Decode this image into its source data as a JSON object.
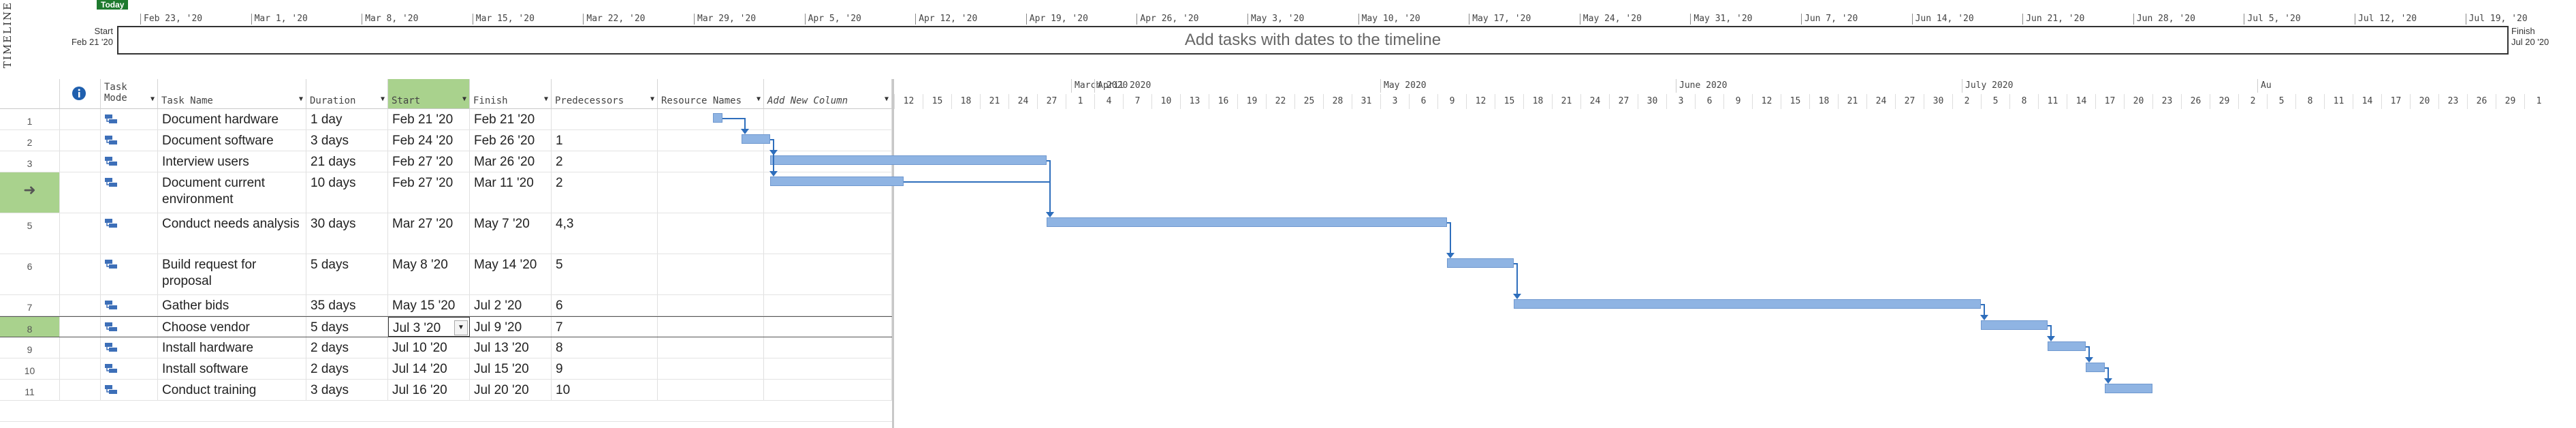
{
  "timeline": {
    "label": "TIMELINE",
    "today": "Today",
    "start_label": "Start",
    "start_date": "Feb 21 '20",
    "finish_label": "Finish",
    "finish_date": "Jul 20 '20",
    "placeholder": "Add tasks with dates to the timeline",
    "ticks": [
      "Feb 23, '20",
      "Mar 1, '20",
      "Mar 8, '20",
      "Mar 15, '20",
      "Mar 22, '20",
      "Mar 29, '20",
      "Apr 5, '20",
      "Apr 12, '20",
      "Apr 19, '20",
      "Apr 26, '20",
      "May 3, '20",
      "May 10, '20",
      "May 17, '20",
      "May 24, '20",
      "May 31, '20",
      "Jun 7, '20",
      "Jun 14, '20",
      "Jun 21, '20",
      "Jun 28, '20",
      "Jul 5, '20",
      "Jul 12, '20",
      "Jul 19, '20"
    ]
  },
  "columns": {
    "info_icon": "info-icon",
    "task_mode": "Task Mode",
    "task_name": "Task Name",
    "duration": "Duration",
    "start": "Start",
    "finish": "Finish",
    "predecessors": "Predecessors",
    "resource_names": "Resource Names",
    "add_new_column": "Add New Column"
  },
  "tasks": [
    {
      "id": "1",
      "name": "Document hardware",
      "duration": "1 day",
      "start": "Feb 21 '20",
      "finish": "Feb 21 '20",
      "pred": ""
    },
    {
      "id": "2",
      "name": "Document software",
      "duration": "3 days",
      "start": "Feb 24 '20",
      "finish": "Feb 26 '20",
      "pred": "1"
    },
    {
      "id": "3",
      "name": "Interview users",
      "duration": "21 days",
      "start": "Feb 27 '20",
      "finish": "Mar 26 '20",
      "pred": "2"
    },
    {
      "id": "4",
      "name": "Document current environment",
      "duration": "10 days",
      "start": "Feb 27 '20",
      "finish": "Mar 11 '20",
      "pred": "2"
    },
    {
      "id": "5",
      "name": "Conduct needs analysis",
      "duration": "30 days",
      "start": "Mar 27 '20",
      "finish": "May 7 '20",
      "pred": "4,3"
    },
    {
      "id": "6",
      "name": "Build request for proposal",
      "duration": "5 days",
      "start": "May 8 '20",
      "finish": "May 14 '20",
      "pred": "5"
    },
    {
      "id": "7",
      "name": "Gather bids",
      "duration": "35 days",
      "start": "May 15 '20",
      "finish": "Jul 2 '20",
      "pred": "6"
    },
    {
      "id": "8",
      "name": "Choose vendor",
      "duration": "5 days",
      "start": "Jul 3 '20",
      "finish": "Jul 9 '20",
      "pred": "7"
    },
    {
      "id": "9",
      "name": "Install hardware",
      "duration": "2 days",
      "start": "Jul 10 '20",
      "finish": "Jul 13 '20",
      "pred": "8"
    },
    {
      "id": "10",
      "name": "Install software",
      "duration": "2 days",
      "start": "Jul 14 '20",
      "finish": "Jul 15 '20",
      "pred": "9"
    },
    {
      "id": "11",
      "name": "Conduct training",
      "duration": "3 days",
      "start": "Jul 16 '20",
      "finish": "Jul 20 '20",
      "pred": "10"
    }
  ],
  "gantt": {
    "months": [
      "March 2020",
      "April 2020",
      "May 2020",
      "June 2020",
      "July 2020",
      "Au"
    ],
    "days": [
      "12",
      "15",
      "18",
      "21",
      "24",
      "27",
      "1",
      "4",
      "7",
      "10",
      "13",
      "16",
      "19",
      "22",
      "25",
      "28",
      "31",
      "3",
      "6",
      "9",
      "12",
      "15",
      "18",
      "21",
      "24",
      "27",
      "30",
      "3",
      "6",
      "9",
      "12",
      "15",
      "18",
      "21",
      "24",
      "27",
      "30",
      "2",
      "5",
      "8",
      "11",
      "14",
      "17",
      "20",
      "23",
      "26",
      "29",
      "2",
      "5",
      "8",
      "11",
      "14",
      "17",
      "20",
      "23",
      "26",
      "29",
      "1"
    ],
    "bar_color": "#8fb4e3",
    "link_color": "#2e6ebc"
  },
  "colors": {
    "selected_header": "#a9d28d",
    "today_badge": "#1e7a2e"
  }
}
